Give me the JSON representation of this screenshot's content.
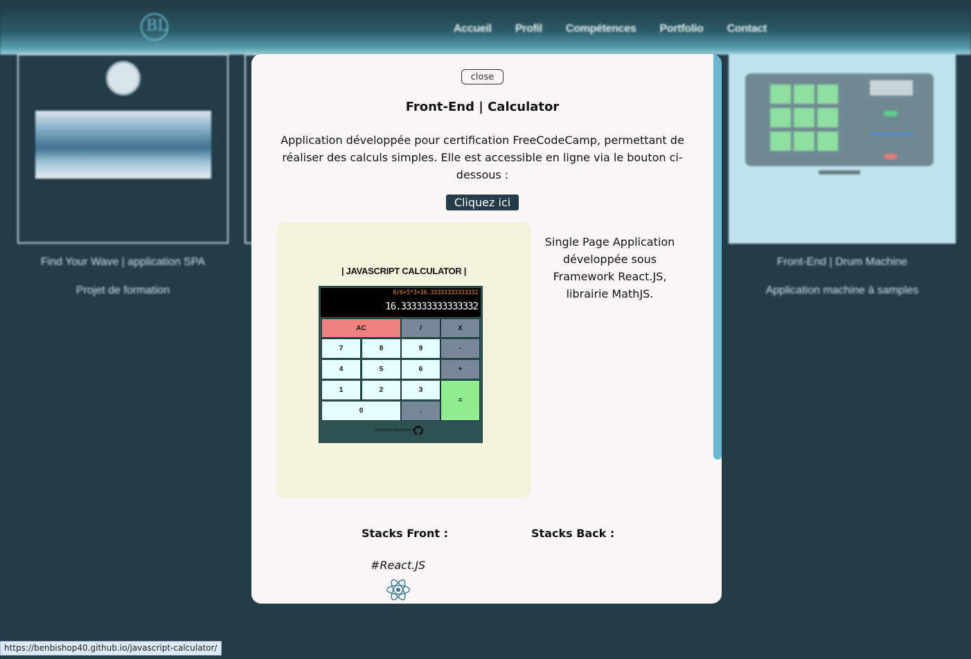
{
  "nav": {
    "logo_text": "BL",
    "links": [
      "Accueil",
      "Profil",
      "Compétences",
      "Portfolio",
      "Contact"
    ]
  },
  "background_cards": [
    {
      "title": "Find Your Wave | application SPA",
      "subtitle": "Projet de formation"
    },
    {
      "title": "Front-End | Drum Machine",
      "subtitle": "Application machine à samples"
    }
  ],
  "modal": {
    "close_label": "close",
    "title": "Front-End | Calculator",
    "description": "Application développée pour certification FreeCodeCamp, permettant de réaliser des calculs simples. Elle est accessible en ligne via le bouton ci-dessous :",
    "cta_label": "Cliquez ici",
    "side_text": "Single Page Application développée sous Framework React.JS, librairie MathJS.",
    "preview": {
      "heading": "| JAVASCRIPT CALCULATOR |",
      "formula": "8/6+5*3+16.33333333333332",
      "result": "16.333333333333332",
      "keys": {
        "ac": "AC",
        "divide": "/",
        "multiply": "X",
        "k7": "7",
        "k8": "8",
        "k9": "9",
        "minus": "-",
        "k4": "4",
        "k5": "5",
        "k6": "6",
        "plus": "+",
        "k1": "1",
        "k2": "2",
        "k3": "3",
        "equals": "=",
        "k0": "0",
        "decimal": "."
      },
      "footer": "CODED BY BEN BISHOP"
    },
    "stacks_front_label": "Stacks Front :",
    "stacks_back_label": "Stacks Back :",
    "front_stack": "#React.JS"
  },
  "status_url": "https://benbishop40.github.io/javascript-calculator/",
  "colors": {
    "page_bg": "#233c48",
    "modal_bg": "#faf6f6",
    "cta_bg": "#233c48",
    "preview_bg": "#f3f3dc",
    "scrollbar": "#6ab8d4",
    "react_blue": "#3a7d96"
  }
}
